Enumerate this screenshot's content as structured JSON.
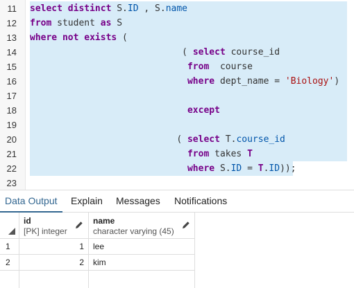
{
  "editor": {
    "lines": [
      {
        "n": "11",
        "tokens": [
          [
            "kw",
            "select distinct "
          ],
          [
            "txt",
            "S."
          ],
          [
            "prop",
            "ID"
          ],
          [
            "txt",
            " , S."
          ],
          [
            "prop",
            "name"
          ]
        ]
      },
      {
        "n": "12",
        "tokens": [
          [
            "kw",
            "from"
          ],
          [
            "txt",
            " student "
          ],
          [
            "kw",
            "as"
          ],
          [
            "txt",
            " S"
          ]
        ]
      },
      {
        "n": "13",
        "tokens": [
          [
            "kw",
            "where not exists"
          ],
          [
            "txt",
            " ("
          ]
        ]
      },
      {
        "n": "14",
        "tokens": [
          [
            "txt",
            "                            ( "
          ],
          [
            "kw",
            "select"
          ],
          [
            "txt",
            " course_id"
          ]
        ]
      },
      {
        "n": "15",
        "tokens": [
          [
            "txt",
            "                             "
          ],
          [
            "kw",
            "from"
          ],
          [
            "txt",
            "  course"
          ]
        ]
      },
      {
        "n": "16",
        "tokens": [
          [
            "txt",
            "                             "
          ],
          [
            "kw",
            "where"
          ],
          [
            "txt",
            " dept_name = "
          ],
          [
            "str",
            "'Biology'"
          ],
          [
            "txt",
            ")"
          ]
        ]
      },
      {
        "n": "17",
        "tokens": []
      },
      {
        "n": "18",
        "tokens": [
          [
            "txt",
            "                             "
          ],
          [
            "kw",
            "except"
          ]
        ]
      },
      {
        "n": "19",
        "tokens": []
      },
      {
        "n": "20",
        "tokens": [
          [
            "txt",
            "                           ( "
          ],
          [
            "kw",
            "select"
          ],
          [
            "txt",
            " T."
          ],
          [
            "prop",
            "course_id"
          ]
        ]
      },
      {
        "n": "21",
        "tokens": [
          [
            "txt",
            "                             "
          ],
          [
            "kw",
            "from"
          ],
          [
            "txt",
            " takes "
          ],
          [
            "kw",
            "T"
          ]
        ]
      },
      {
        "n": "22",
        "tokens": [
          [
            "txt",
            "                             "
          ],
          [
            "kw",
            "where"
          ],
          [
            "txt",
            " S."
          ],
          [
            "prop",
            "ID"
          ],
          [
            "txt",
            " = "
          ],
          [
            "kw",
            "T"
          ],
          [
            "txt",
            "."
          ],
          [
            "prop",
            "ID"
          ],
          [
            "txt",
            "));"
          ]
        ]
      },
      {
        "n": "23",
        "tokens": []
      }
    ]
  },
  "tabs": {
    "data_output": "Data Output",
    "explain": "Explain",
    "messages": "Messages",
    "notifications": "Notifications"
  },
  "grid": {
    "columns": [
      {
        "name": "id",
        "type": "[PK] integer"
      },
      {
        "name": "name",
        "type": "character varying (45)"
      }
    ],
    "rows": [
      {
        "num": "1",
        "id": "1",
        "name": "lee"
      },
      {
        "num": "2",
        "id": "2",
        "name": "kim"
      }
    ]
  },
  "colors": {
    "selection": "#d8ecf8",
    "keyword": "#770088",
    "string": "#aa1111",
    "property": "#0055aa",
    "active_tab": "#326690"
  },
  "icons": [
    "pencil-icon",
    "sort-corner-icon"
  ]
}
